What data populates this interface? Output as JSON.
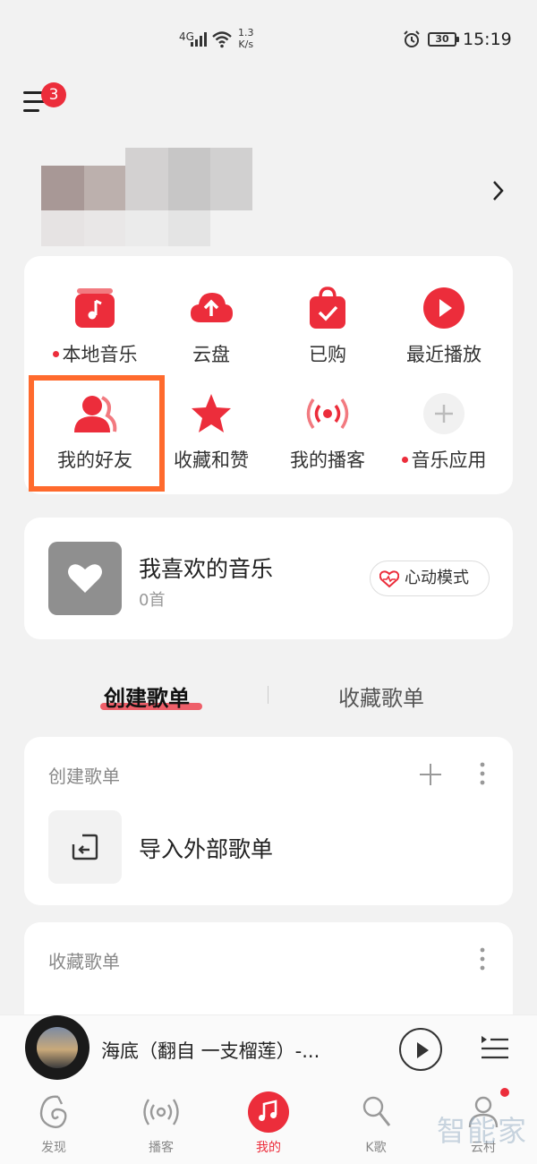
{
  "status_bar": {
    "network": "4G",
    "speed_value": "1.3",
    "speed_unit": "K/s",
    "battery": "30",
    "time": "15:19"
  },
  "header": {
    "menu_badge": "3"
  },
  "quick_grid": {
    "items": [
      {
        "label": "本地音乐",
        "icon": "local-music-icon",
        "dot": true
      },
      {
        "label": "云盘",
        "icon": "cloud-upload-icon",
        "dot": false
      },
      {
        "label": "已购",
        "icon": "shopping-bag-icon",
        "dot": false
      },
      {
        "label": "最近播放",
        "icon": "play-circle-icon",
        "dot": false
      },
      {
        "label": "我的好友",
        "icon": "friends-icon",
        "dot": false
      },
      {
        "label": "收藏和赞",
        "icon": "star-icon",
        "dot": false
      },
      {
        "label": "我的播客",
        "icon": "broadcast-icon",
        "dot": false
      },
      {
        "label": "音乐应用",
        "icon": "plus-icon",
        "dot": true
      }
    ]
  },
  "favorite": {
    "title": "我喜欢的音乐",
    "count": "0首",
    "mode_label": "心动模式"
  },
  "playlist_tabs": {
    "created": "创建歌单",
    "collected": "收藏歌单"
  },
  "created_section": {
    "title": "创建歌单",
    "import_label": "导入外部歌单"
  },
  "collected_section": {
    "title": "收藏歌单"
  },
  "player": {
    "song": "海底（翻自 一支榴莲）-..."
  },
  "bottom_nav": {
    "items": [
      {
        "label": "发现"
      },
      {
        "label": "播客"
      },
      {
        "label": "我的"
      },
      {
        "label": "K歌"
      },
      {
        "label": "云村"
      }
    ]
  },
  "watermark": "智能家",
  "colors": {
    "accent": "#ec2d3b",
    "highlight": "#ff6a2d",
    "background": "#f2f2f2"
  }
}
